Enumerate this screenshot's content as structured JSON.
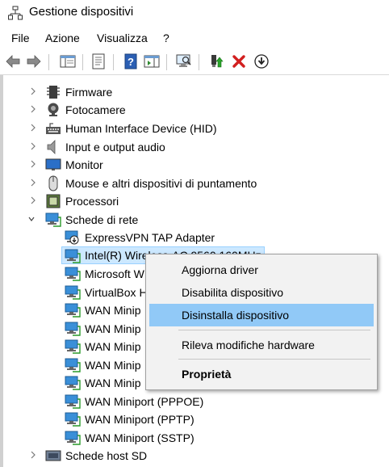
{
  "window": {
    "title": "Gestione dispositivi"
  },
  "menu": {
    "file": "File",
    "azione": "Azione",
    "visualizza": "Visualizza",
    "help": "?"
  },
  "tree": {
    "firmware": "Firmware",
    "fotocamere": "Fotocamere",
    "hid": "Human Interface Device (HID)",
    "audio": "Input e output audio",
    "monitor": "Monitor",
    "mouse": "Mouse e altri dispositivi di puntamento",
    "processori": "Processori",
    "schede_rete": "Schede di rete",
    "network_children": [
      "ExpressVPN TAP Adapter",
      "Intel(R) Wireless-AC 9560 160MHz",
      "Microsoft W",
      "VirtualBox H",
      "WAN Minip",
      "WAN Minip",
      "WAN Minip",
      "WAN Minip",
      "WAN Minip",
      "WAN Miniport (PPPOE)",
      "WAN Miniport (PPTP)",
      "WAN Miniport (SSTP)"
    ],
    "schede_host_sd": "Schede host SD"
  },
  "context_menu": {
    "aggiorna": "Aggiorna driver",
    "disabilita": "Disabilita dispositivo",
    "disinstalla": "Disinstalla dispositivo",
    "rileva": "Rileva modifiche hardware",
    "proprieta": "Proprietà"
  },
  "colors": {
    "highlight": "#91c9f7",
    "selection": "#cce8ff",
    "menu_bg": "#f2f2f2"
  }
}
